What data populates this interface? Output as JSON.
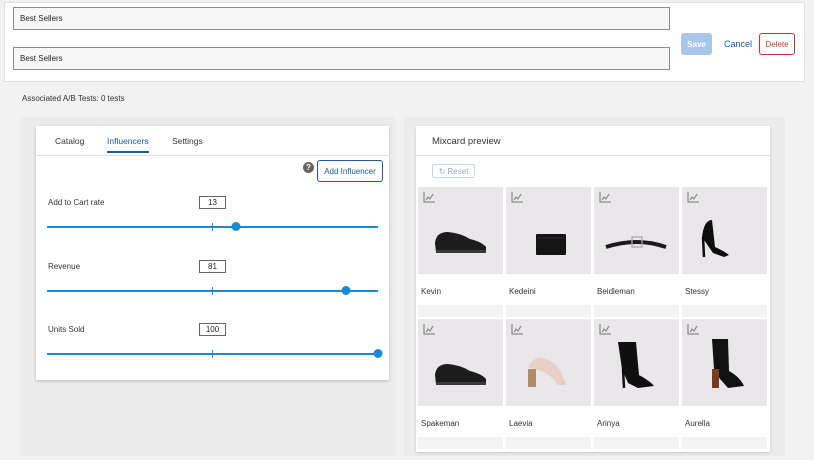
{
  "header": {
    "title_value": "Best Sellers",
    "description_value": "Best Sellers",
    "save_label": "Save",
    "cancel_label": "Cancel",
    "delete_label": "Delete"
  },
  "ab_tests": "Associated A/B Tests: 0 tests",
  "influencers": {
    "tabs": [
      "Catalog",
      "Influencers",
      "Settings"
    ],
    "active_tab": "Influencers",
    "help_icon": "?",
    "add_label": "Add Influencer",
    "sliders": [
      {
        "label": "Add to Cart rate",
        "value": "13",
        "fraction": 0.57
      },
      {
        "label": "Revenue",
        "value": "81",
        "fraction": 0.904
      },
      {
        "label": "Units Sold",
        "value": "100",
        "fraction": 1.0
      }
    ]
  },
  "preview": {
    "title": "Mixcard preview",
    "reset_label": "Reset",
    "reset_icon": "refresh-icon",
    "products": [
      {
        "name": "Kevin",
        "type": "oxford-shoe"
      },
      {
        "name": "Kedeini",
        "type": "wallet"
      },
      {
        "name": "Beidleman",
        "type": "belt"
      },
      {
        "name": "Stessy",
        "type": "stiletto-pump"
      },
      {
        "name": "Spakeman",
        "type": "oxford-shoe"
      },
      {
        "name": "Laevia",
        "type": "block-heel-sandal"
      },
      {
        "name": "Arinya",
        "type": "stiletto-bootie"
      },
      {
        "name": "Aurella",
        "type": "block-heel-bootie"
      }
    ]
  },
  "colors": {
    "accent": "#1a5aa0",
    "slider": "#1e88d8",
    "delete": "#cc3333",
    "save_disabled": "#a9c5e8"
  }
}
